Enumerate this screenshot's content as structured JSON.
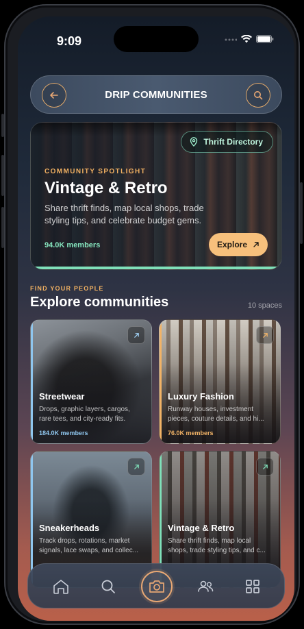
{
  "status": {
    "time": "9:09"
  },
  "header": {
    "title": "DRIP COMMUNITIES"
  },
  "spotlight": {
    "eyebrow": "COMMUNITY SPOTLIGHT",
    "title": "Vintage & Retro",
    "description": "Share thrift finds, map local shops, trade styling tips, and celebrate budget gems.",
    "members": "94.0K members",
    "directory_label": "Thrift Directory",
    "explore_label": "Explore"
  },
  "section": {
    "eyebrow": "FIND YOUR PEOPLE",
    "title": "Explore communities",
    "count": "10 spaces"
  },
  "communities": [
    {
      "name": "Streetwear",
      "description": "Drops, graphic layers, cargos, rare tees, and city-ready fits.",
      "members": "184.0K members",
      "accent": "#8fc6ee"
    },
    {
      "name": "Luxury Fashion",
      "description": "Runway houses, investment pieces, couture details, and hi...",
      "members": "76.0K members",
      "accent": "#f2b366"
    },
    {
      "name": "Sneakerheads",
      "description": "Track drops, rotations, market signals, lace swaps, and collec...",
      "members": "",
      "accent": "#8fc6ee"
    },
    {
      "name": "Vintage & Retro",
      "description": "Share thrift finds, map local shops, trade styling tips, and c...",
      "members": "",
      "accent": "#7fe0b9"
    }
  ],
  "nav": {
    "items": [
      "home-icon",
      "search-icon",
      "camera-icon",
      "people-icon",
      "grid-icon"
    ]
  },
  "colors": {
    "accent_orange": "#e8a874",
    "accent_mint": "#7fe0b9",
    "accent_blue": "#8fc6ee"
  }
}
